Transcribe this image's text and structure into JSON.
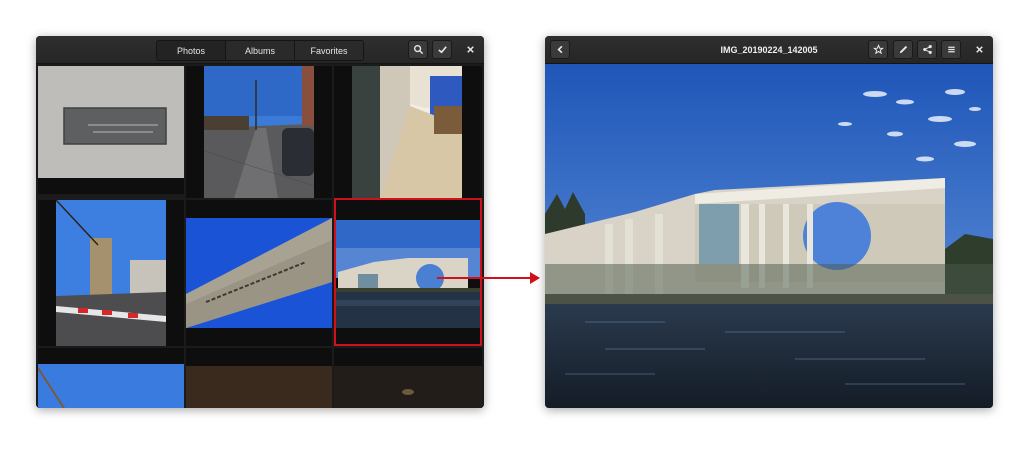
{
  "gallery": {
    "tabs": [
      {
        "label": "Photos",
        "active": true
      },
      {
        "label": "Albums",
        "active": false
      },
      {
        "label": "Favorites",
        "active": false
      }
    ],
    "icons": {
      "search": "search-icon",
      "select": "checkmark-icon",
      "close": "close-icon"
    }
  },
  "viewer": {
    "title": "IMG_20190224_142005",
    "icons": {
      "back": "back-icon",
      "favorite": "star-icon",
      "edit": "pencil-icon",
      "share": "share-icon",
      "menu": "menu-icon",
      "close": "close-icon"
    }
  },
  "annotation": {
    "highlight_color": "#d0101a",
    "arrow_color": "#d0101a"
  }
}
